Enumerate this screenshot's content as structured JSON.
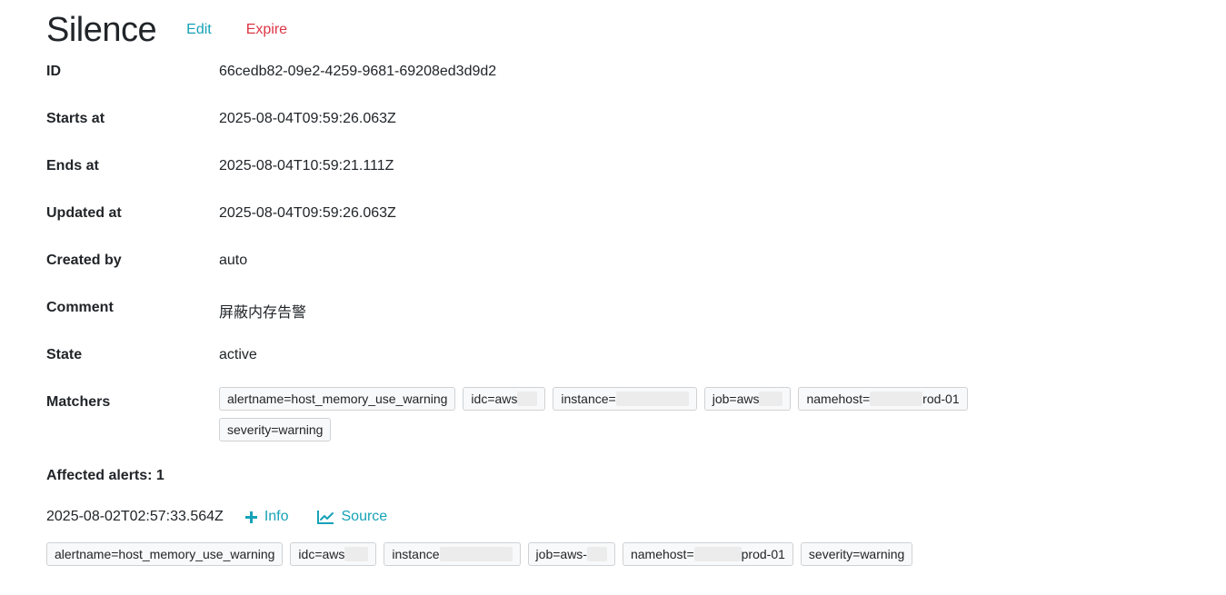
{
  "header": {
    "title": "Silence",
    "edit_label": "Edit",
    "expire_label": "Expire"
  },
  "details": {
    "id_label": "ID",
    "id_value": "66cedb82-09e2-4259-9681-69208ed3d9d2",
    "starts_label": "Starts at",
    "starts_value": "2025-08-04T09:59:26.063Z",
    "ends_label": "Ends at",
    "ends_value": "2025-08-04T10:59:21.111Z",
    "updated_label": "Updated at",
    "updated_value": "2025-08-04T09:59:26.063Z",
    "created_label": "Created by",
    "created_value": "auto",
    "comment_label": "Comment",
    "comment_value": "屏蔽内存告警",
    "state_label": "State",
    "state_value": "active",
    "matchers_label": "Matchers"
  },
  "matchers": [
    {
      "text": "alertname=host_memory_use_warning"
    },
    {
      "text": "idc=aws",
      "suffix": ""
    },
    {
      "text": "instance=",
      "suffix": ""
    },
    {
      "text": "job=aws",
      "suffix": ""
    },
    {
      "text": "namehost=",
      "suffix": "rod-01"
    },
    {
      "text": "severity=warning"
    }
  ],
  "affected": {
    "heading": "Affected alerts: 1",
    "timestamp": "2025-08-02T02:57:33.564Z",
    "info_label": "Info",
    "source_label": "Source",
    "labels": [
      {
        "text": "alertname=host_memory_use_warning"
      },
      {
        "text": "idc=aws",
        "suffix": ""
      },
      {
        "text": "instance",
        "suffix": ""
      },
      {
        "text": "job=aws-",
        "suffix": ""
      },
      {
        "text": "namehost=",
        "suffix": "prod-01"
      },
      {
        "text": "severity=warning"
      }
    ]
  },
  "colors": {
    "link": "#17a2b8",
    "danger": "#dc3545",
    "chip_bg": "#f8f9fa",
    "chip_border": "#cfd2d5"
  },
  "icons": {
    "info": "plus-icon",
    "source": "chart-line-icon"
  }
}
